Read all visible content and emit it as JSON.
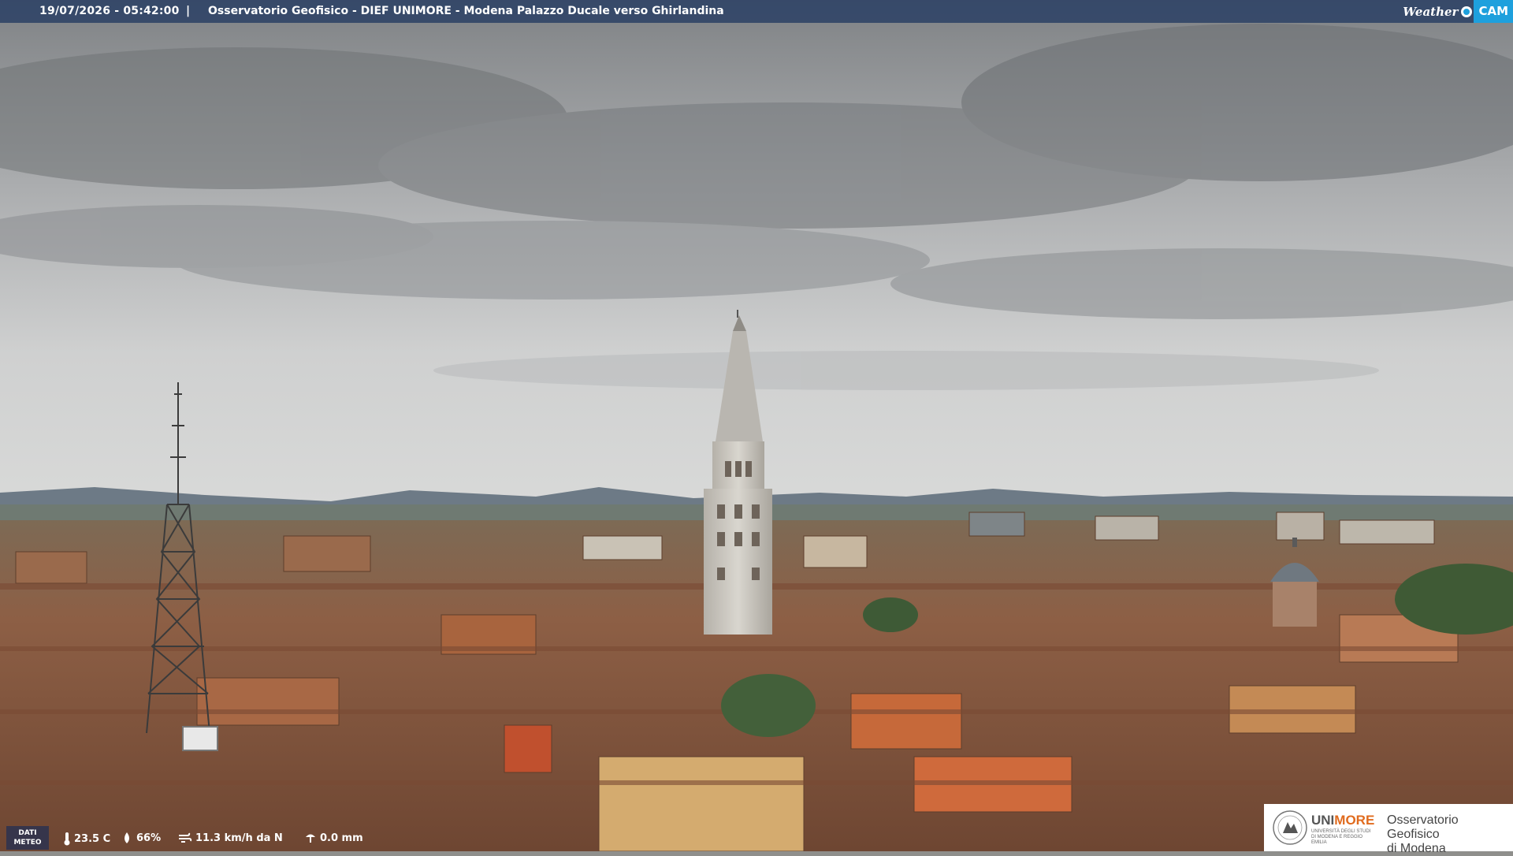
{
  "overlay": {
    "timestamp": "19/07/2026 - 05:42:00",
    "separator": "|",
    "title": "Osservatorio Geofisico - DIEF UNIMORE - Modena Palazzo Ducale verso Ghirlandina",
    "brand_weather": "Weather",
    "brand_cam": "CAM"
  },
  "meteo": {
    "label_line1": "DATI",
    "label_line2": "METEO",
    "temperature": "23.5 C",
    "humidity": "66%",
    "wind": "11.3 km/h da N",
    "rain": "0.0 mm",
    "icons": [
      "thermometer-icon",
      "humidity-drop-icon",
      "wind-icon",
      "rain-gauge-icon"
    ]
  },
  "logo": {
    "uni": "UNI",
    "more": "MORE",
    "subtitle": "UNIVERSITÀ DEGLI STUDI DI MODENA E REGGIO EMILIA",
    "obs_line1": "Osservatorio Geofisico",
    "obs_line2": "di Modena"
  },
  "colors": {
    "topbar": "#233a62",
    "brand_cam": "#1ea0dd",
    "unimore_orange": "#e06b1e"
  }
}
